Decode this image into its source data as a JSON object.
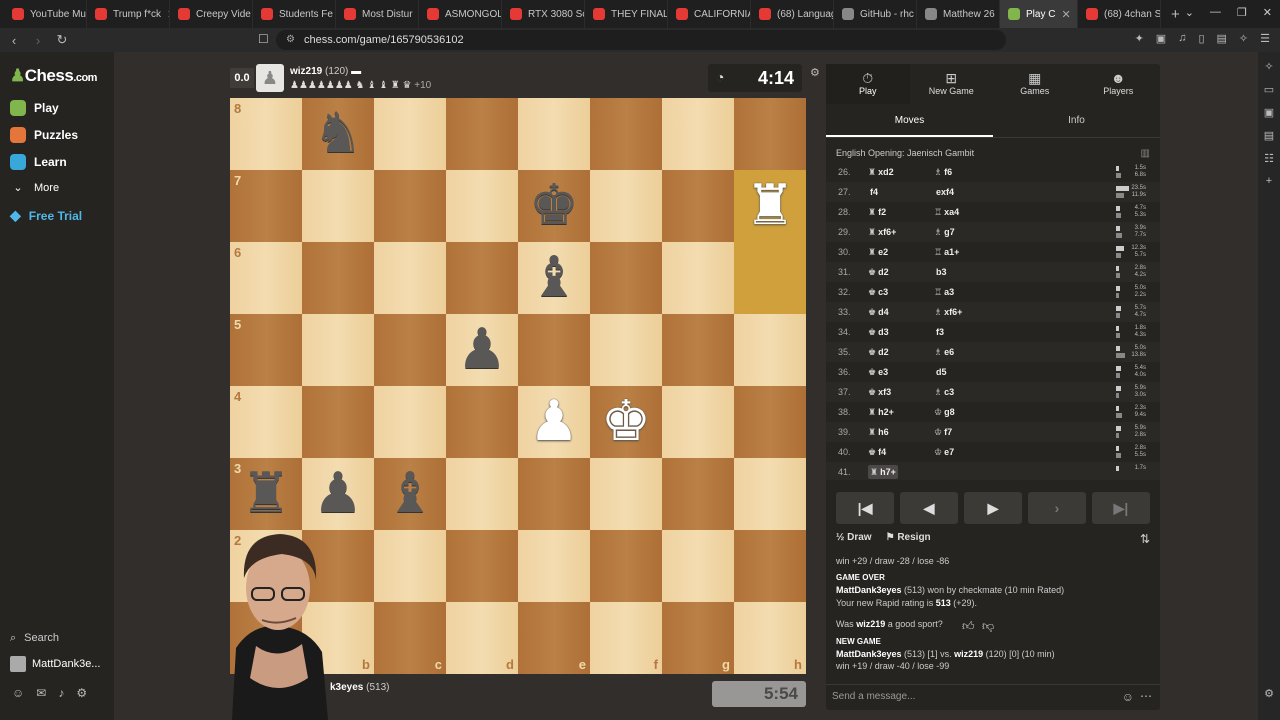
{
  "browser": {
    "tabs": [
      {
        "title": "YouTube Mu",
        "color": "#e53935"
      },
      {
        "title": "Trump f*ck",
        "color": "#e53935"
      },
      {
        "title": "Creepy Vide",
        "color": "#e53935"
      },
      {
        "title": "Students Fe",
        "color": "#e53935"
      },
      {
        "title": "Most Distur",
        "color": "#e53935"
      },
      {
        "title": "ASMONGOL",
        "color": "#e53935"
      },
      {
        "title": "RTX 3080 Sc",
        "color": "#e53935"
      },
      {
        "title": "THEY FINALL",
        "color": "#e53935"
      },
      {
        "title": "CALIFORNIA",
        "color": "#e53935"
      },
      {
        "title": "(68) Languag",
        "color": "#e53935"
      },
      {
        "title": "GitHub - rhc",
        "color": "#888888"
      },
      {
        "title": "Matthew 26",
        "color": "#888888"
      },
      {
        "title": "Play C",
        "color": "#81b64c"
      },
      {
        "title": "(68) 4chan S",
        "color": "#e53935"
      }
    ],
    "url": "chess.com/game/165790536102"
  },
  "nav": {
    "logo": "Chess",
    "logo_suffix": ".com",
    "play": "Play",
    "puzzles": "Puzzles",
    "learn": "Learn",
    "more": "More",
    "free_trial": "Free Trial",
    "search": "Search",
    "username": "MattDank3e..."
  },
  "top_player": {
    "eval": "0.0",
    "name": "wiz219",
    "rating": "(120)",
    "captured": "♟♟♟♟♟♟♟ ♞ ♝ ♝ ♜ ♛",
    "advantage": "+10",
    "clock": "4:14"
  },
  "bottom_player": {
    "name": "k3eyes",
    "rating": "(513)",
    "clock": "5:54"
  },
  "board": {
    "ranks": [
      "8",
      "7",
      "6",
      "5",
      "4",
      "3",
      "2"
    ],
    "files": [
      "b",
      "c",
      "d",
      "e",
      "f",
      "g",
      "h"
    ]
  },
  "panel": {
    "tabs": [
      "Play",
      "New Game",
      "Games",
      "Players"
    ],
    "subtabs": [
      "Moves",
      "Info"
    ],
    "opening": "English Opening: Jaenisch Gambit",
    "moves": [
      {
        "n": "26.",
        "w": "xd2",
        "wp": "♜",
        "b": "f6",
        "bp": "♗",
        "t1": "1.5s",
        "t2": "6.8s",
        "f1": 0.1,
        "f2": 0.2
      },
      {
        "n": "27.",
        "w": "f4",
        "wp": "",
        "b": "exf4",
        "bp": "",
        "t1": "23.5s",
        "t2": "11.9s",
        "f1": 0.8,
        "f2": 0.4
      },
      {
        "n": "28.",
        "w": "f2",
        "wp": "♜",
        "b": "xa4",
        "bp": "♖",
        "t1": "4.7s",
        "t2": "5.3s",
        "f1": 0.15,
        "f2": 0.18
      },
      {
        "n": "29.",
        "w": "xf6+",
        "wp": "♜",
        "b": "g7",
        "bp": "♗",
        "t1": "3.9s",
        "t2": "7.7s",
        "f1": 0.13,
        "f2": 0.26
      },
      {
        "n": "30.",
        "w": "e2",
        "wp": "♜",
        "b": "a1+",
        "bp": "♖",
        "t1": "12.3s",
        "t2": "5.7s",
        "f1": 0.42,
        "f2": 0.19
      },
      {
        "n": "31.",
        "w": "d2",
        "wp": "♚",
        "b": "b3",
        "bp": "",
        "t1": "2.8s",
        "t2": "4.2s",
        "f1": 0.1,
        "f2": 0.14
      },
      {
        "n": "32.",
        "w": "c3",
        "wp": "♚",
        "b": "a3",
        "bp": "♖",
        "t1": "5.0s",
        "t2": "2.2s",
        "f1": 0.17,
        "f2": 0.07
      },
      {
        "n": "33.",
        "w": "d4",
        "wp": "♚",
        "b": "xf6+",
        "bp": "♗",
        "t1": "5.7s",
        "t2": "4.7s",
        "f1": 0.19,
        "f2": 0.16
      },
      {
        "n": "34.",
        "w": "d3",
        "wp": "♚",
        "b": "f3",
        "bp": "",
        "t1": "1.8s",
        "t2": "4.3s",
        "f1": 0.06,
        "f2": 0.15
      },
      {
        "n": "35.",
        "w": "d2",
        "wp": "♚",
        "b": "e6",
        "bp": "♗",
        "t1": "5.0s",
        "t2": "13.8s",
        "f1": 0.17,
        "f2": 0.47
      },
      {
        "n": "36.",
        "w": "e3",
        "wp": "♚",
        "b": "d5",
        "bp": "",
        "t1": "5.4s",
        "t2": "4.0s",
        "f1": 0.18,
        "f2": 0.13
      },
      {
        "n": "37.",
        "w": "xf3",
        "wp": "♚",
        "b": "c3",
        "bp": "♗",
        "t1": "5.9s",
        "t2": "3.0s",
        "f1": 0.2,
        "f2": 0.1
      },
      {
        "n": "38.",
        "w": "h2+",
        "wp": "♜",
        "b": "g8",
        "bp": "♔",
        "t1": "2.3s",
        "t2": "9.4s",
        "f1": 0.08,
        "f2": 0.32
      },
      {
        "n": "39.",
        "w": "h6",
        "wp": "♜",
        "b": "f7",
        "bp": "♔",
        "t1": "5.9s",
        "t2": "2.8s",
        "f1": 0.2,
        "f2": 0.09
      },
      {
        "n": "40.",
        "w": "f4",
        "wp": "♚",
        "b": "e7",
        "bp": "♔",
        "t1": "2.8s",
        "t2": "5.5s",
        "f1": 0.09,
        "f2": 0.19
      },
      {
        "n": "41.",
        "w": "h7+",
        "wp": "♜",
        "b": "",
        "bp": "",
        "t1": "1.7s",
        "t2": "",
        "f1": 0.06,
        "f2": 0
      }
    ],
    "draw": "Draw",
    "resign": "Resign",
    "log": {
      "line1": "win +29 / draw -28 / lose -86",
      "game_over": "GAME OVER",
      "result_name": "MattDank3eyes",
      "result_text": "(513) won by checkmate (10 min Rated)",
      "rating_line": "Your new Rapid rating is",
      "rating_value": "513",
      "rating_delta": "(+29).",
      "sport_prefix": "Was",
      "sport_name": "wiz219",
      "sport_suffix": "a good sport?",
      "new_game": "NEW GAME",
      "ng_p1": "MattDank3eyes",
      "ng_mid": "(513) [1] vs.",
      "ng_p2": "wiz219",
      "ng_tail": "(120) [0] (10 min)",
      "ng_odds": "win +19 / draw -40 / lose -99"
    },
    "message_placeholder": "Send a message..."
  }
}
